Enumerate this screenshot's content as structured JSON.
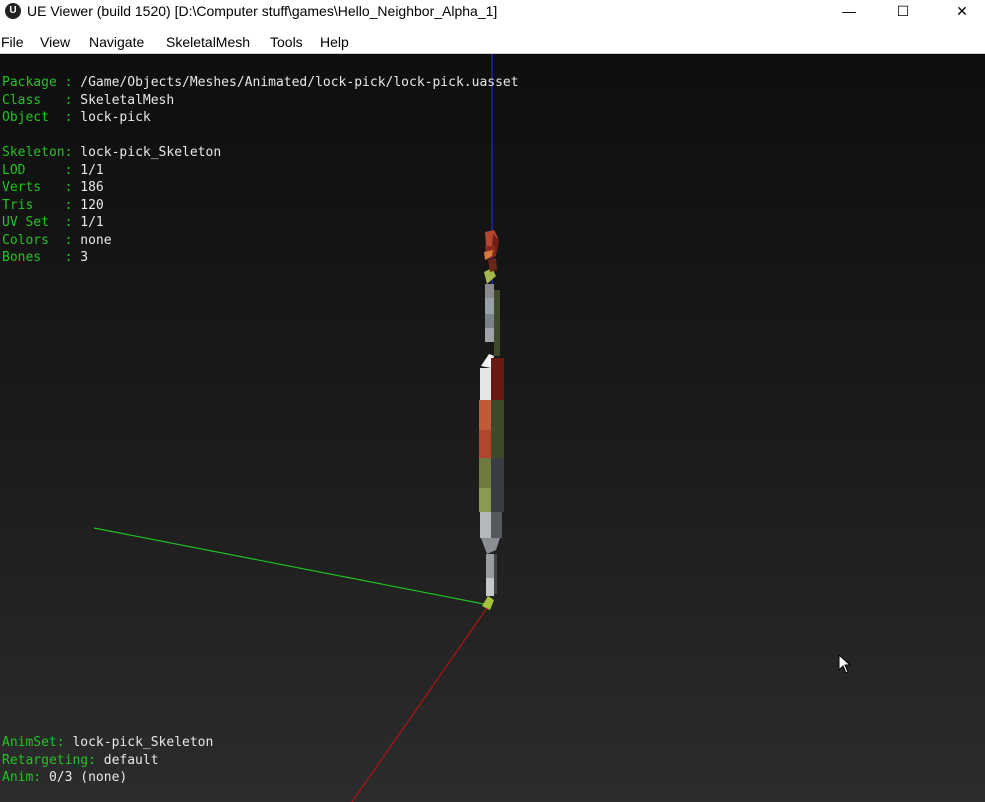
{
  "window": {
    "title": "UE Viewer (build 1520) [D:\\Computer stuff\\games\\Hello_Neighbor_Alpha_1]",
    "app_icon": "U",
    "controls": {
      "minimize": "—",
      "maximize": "☐",
      "close": "✕"
    }
  },
  "menu": [
    "File",
    "View",
    "Navigate",
    "SkeletalMesh",
    "Tools",
    "Help"
  ],
  "info": {
    "package": {
      "key": "Package : ",
      "value": "/Game/Objects/Meshes/Animated/lock-pick/lock-pick.uasset"
    },
    "class": {
      "key": "Class   : ",
      "value": "SkeletalMesh"
    },
    "object": {
      "key": "Object  : ",
      "value": "lock-pick"
    },
    "skeleton": {
      "key": "Skeleton: ",
      "value": "lock-pick_Skeleton"
    },
    "lod": {
      "key": "LOD     : ",
      "value": "1/1"
    },
    "verts": {
      "key": "Verts   : ",
      "value": "186"
    },
    "tris": {
      "key": "Tris    : ",
      "value": "120"
    },
    "uvset": {
      "key": "UV Set  : ",
      "value": "1/1"
    },
    "colors": {
      "key": "Colors  : ",
      "value": "none"
    },
    "bones": {
      "key": "Bones   : ",
      "value": "3"
    }
  },
  "anim": {
    "animset": {
      "key": "AnimSet: ",
      "value": "lock-pick_Skeleton"
    },
    "retargeting": {
      "key": "Retargeting: ",
      "value": "default"
    },
    "anim": {
      "key": "Anim: ",
      "value": "0/3 (none)"
    }
  },
  "colors": {
    "text_key": "#22c222",
    "text_value": "#e8e8e8",
    "axis_x": "#b01515",
    "axis_y": "#1fc21f",
    "axis_z": "#1a2ad6"
  }
}
